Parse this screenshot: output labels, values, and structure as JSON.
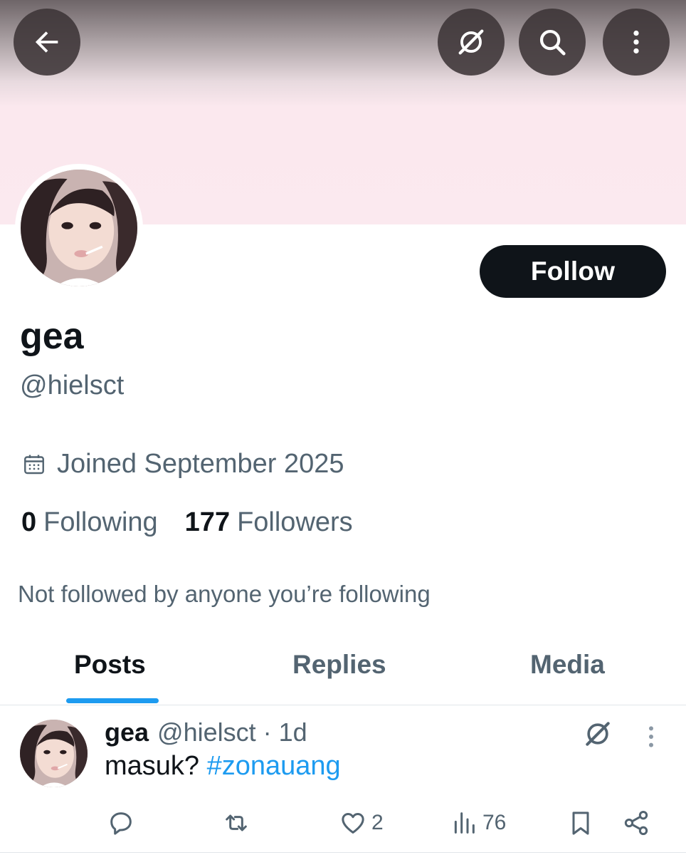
{
  "header": {
    "back_icon": "arrow-left-icon",
    "grok_icon": "grok-icon",
    "search_icon": "search-icon",
    "more_icon": "more-vertical-icon"
  },
  "profile": {
    "display_name": "gea",
    "handle": "@hielsct",
    "follow_label": "Follow",
    "joined": "Joined September 2025",
    "following_count": "0",
    "following_label": "Following",
    "followers_count": "177",
    "followers_label": "Followers",
    "not_followed_text": "Not followed by anyone you’re following"
  },
  "tabs": [
    {
      "label": "Posts",
      "active": true
    },
    {
      "label": "Replies",
      "active": false
    },
    {
      "label": "Media",
      "active": false
    }
  ],
  "post": {
    "name": "gea",
    "meta": "@hielsct · 1d",
    "text": "masuk? ",
    "hashtag": "#zonauang",
    "likes": "2",
    "views": "76"
  },
  "colors": {
    "accent": "#1d9bf0",
    "text_primary": "#0f1419",
    "text_secondary": "#536471",
    "banner": "#fbe9ef"
  }
}
